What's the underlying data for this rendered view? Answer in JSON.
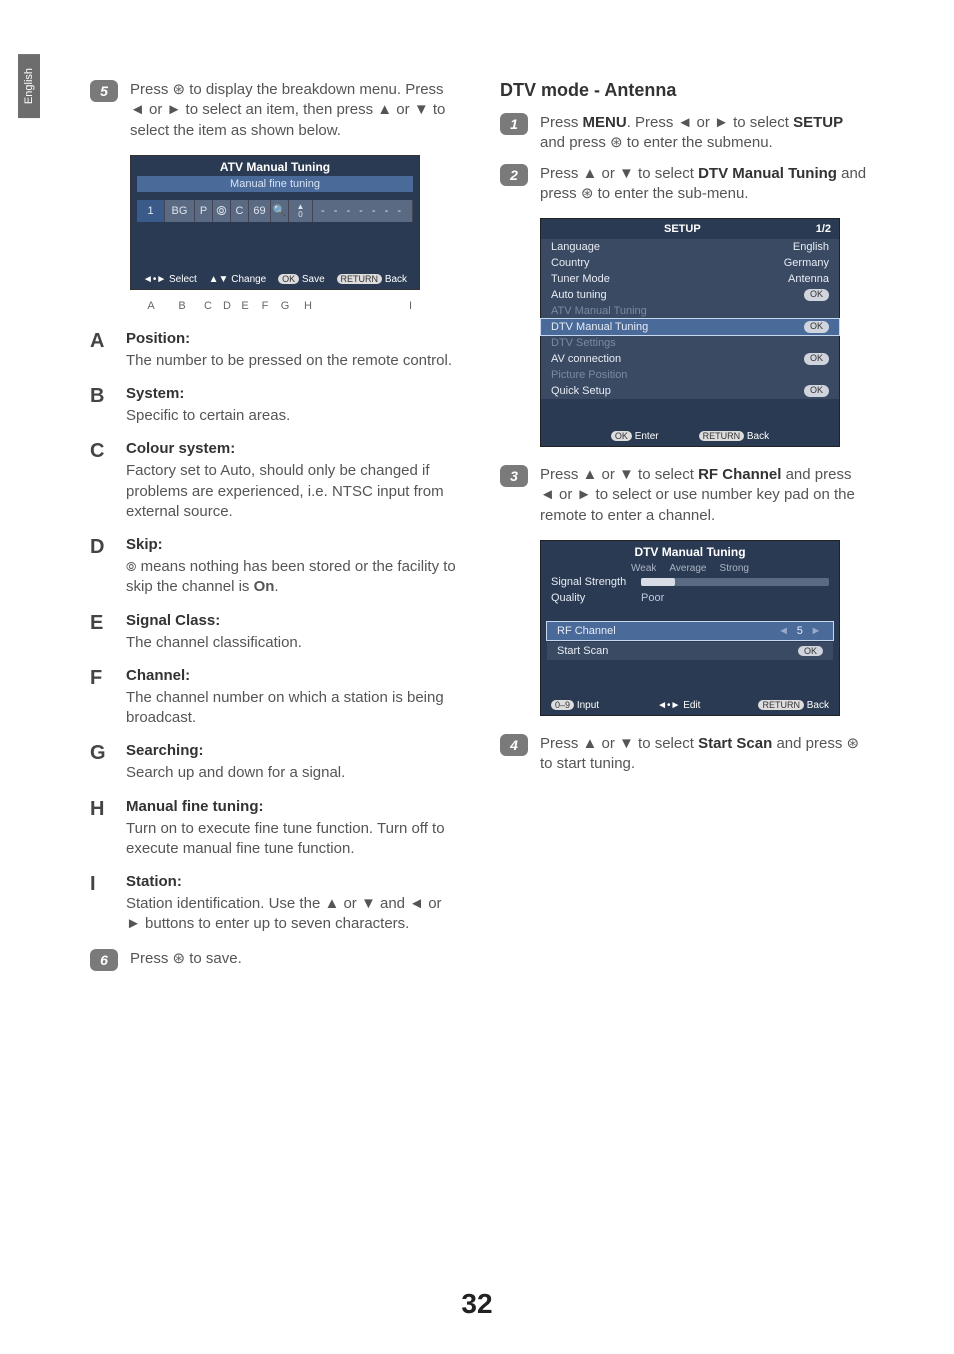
{
  "lang_tab": "English",
  "page_number": "32",
  "left": {
    "step5": "Press ⊛ to display the breakdown menu. Press ◄ or ► to select an item, then press ▲ or ▼ to select the item as shown below.",
    "atv": {
      "title": "ATV Manual Tuning",
      "subtitle": "Manual fine tuning",
      "cells": {
        "a": "1",
        "b": "BG",
        "c": "P",
        "d": "👁",
        "e": "C",
        "f": "69",
        "g": "🔍",
        "h": "0",
        "i": "- - - - - - -"
      },
      "foot": {
        "select": "Select",
        "change": "Change",
        "save": "Save",
        "back": "Back",
        "ok": "OK",
        "ret": "RETURN"
      },
      "letters": [
        "A",
        "B",
        "C",
        "D",
        "E",
        "F",
        "G",
        "H",
        "I"
      ]
    },
    "items": {
      "A": {
        "title": "Position:",
        "desc": "The number to be pressed on the remote control."
      },
      "B": {
        "title": "System:",
        "desc": "Specific to certain areas."
      },
      "C": {
        "title": "Colour system:",
        "desc": "Factory set to Auto, should only be changed if problems are experienced, i.e. NTSC input from external source."
      },
      "D": {
        "title": "Skip:",
        "desc": "👁 means nothing has been stored or the facility to skip the channel is On."
      },
      "E": {
        "title": "Signal Class:",
        "desc": "The channel classification."
      },
      "F": {
        "title": "Channel:",
        "desc": "The channel number on which a station is being broadcast."
      },
      "G": {
        "title": "Searching:",
        "desc": "Search up and down for a signal."
      },
      "H": {
        "title": "Manual fine tuning:",
        "desc": "Turn on to execute fine tune function. Turn off to execute manual fine tune function."
      },
      "I": {
        "title": "Station:",
        "desc": "Station identification. Use the ▲ or ▼ and ◄ or ► buttons to enter up to seven characters."
      }
    },
    "step6": "Press ⊛ to save."
  },
  "right": {
    "heading": "DTV mode - Antenna",
    "step1_a": "Press ",
    "step1_menu": "MENU",
    "step1_b": ". Press ◄ or ► to select ",
    "step1_setup": "SETUP",
    "step1_c": " and press ⊛ to enter the submenu.",
    "step2_a": "Press ▲ or ▼ to select ",
    "step2_b": "DTV Manual Tuning",
    "step2_c": " and press ⊛ to enter the sub-menu.",
    "setup": {
      "title": "SETUP",
      "page": "1/2",
      "rows": [
        {
          "label": "Language",
          "value": "English"
        },
        {
          "label": "Country",
          "value": "Germany"
        },
        {
          "label": "Tuner Mode",
          "value": "Antenna"
        },
        {
          "label": "Auto tuning",
          "value": "OK"
        },
        {
          "label": "ATV Manual Tuning",
          "value": ""
        },
        {
          "label": "DTV Manual Tuning",
          "value": "OK"
        },
        {
          "label": "DTV Settings",
          "value": ""
        },
        {
          "label": "AV connection",
          "value": "OK"
        },
        {
          "label": "Picture Position",
          "value": ""
        },
        {
          "label": "Quick Setup",
          "value": "OK"
        }
      ],
      "foot_enter": "Enter",
      "foot_back": "Back",
      "foot_ok": "OK",
      "foot_ret": "RETURN"
    },
    "step3_a": "Press ▲ or ▼ to select ",
    "step3_b": "RF Channel",
    "step3_c": " and press ◄ or ► to select or use number key pad on the remote to enter a channel.",
    "dtv": {
      "title": "DTV Manual Tuning",
      "weak": "Weak",
      "avg": "Average",
      "strong": "Strong",
      "sig": "Signal Strength",
      "qual": "Quality",
      "poor": "Poor",
      "rf": "RF Channel",
      "rfval": "5",
      "start": "Start Scan",
      "ok": "OK",
      "input": "Input",
      "inpill": "0–9",
      "edit": "Edit",
      "back": "Back",
      "ret": "RETURN"
    },
    "step4_a": "Press ▲ or ▼ to select ",
    "step4_b": "Start Scan",
    "step4_c": " and press ⊛ to start tuning."
  }
}
